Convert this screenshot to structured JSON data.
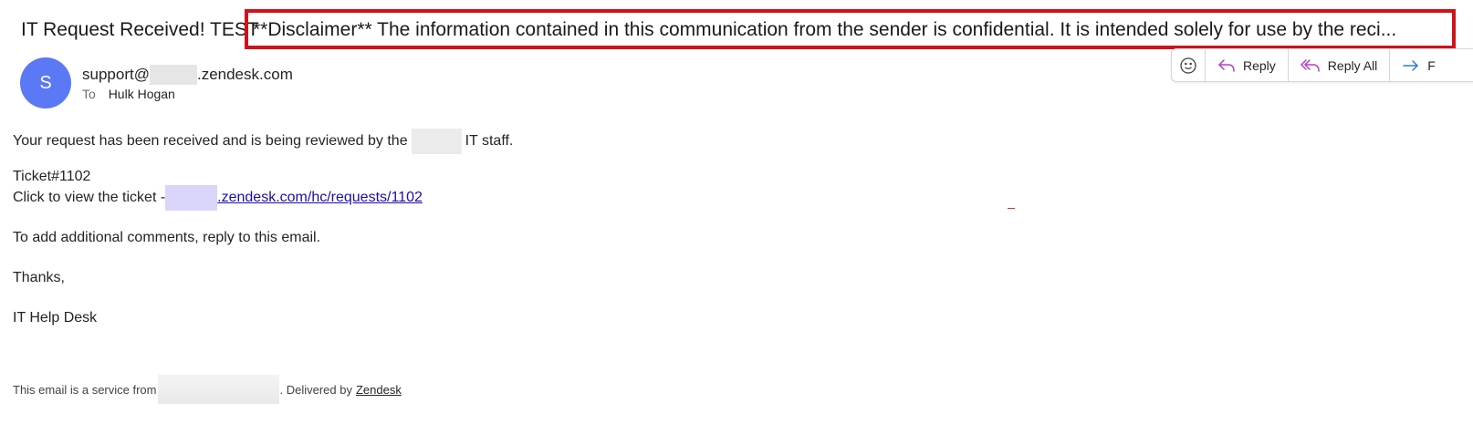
{
  "email": {
    "subject_prefix": "IT Request Received! TEST",
    "subject_disclaimer": "**Disclaimer** The information contained in this communication from the sender is confidential. It is intended solely for use by the reci...",
    "highlight_color": "#d0121b",
    "sender": {
      "avatar_initial": "S",
      "avatar_color": "#5b78f5",
      "address_prefix": "support@",
      "address_suffix": ".zendesk.com"
    },
    "recipient": {
      "label": "To",
      "name": "Hulk Hogan"
    }
  },
  "actions": {
    "emoji_icon": "smiley-icon",
    "reply_label": "Reply",
    "reply_all_label": "Reply All",
    "forward_label": "F"
  },
  "body": {
    "line1_before": "Your request has been received and is being reviewed by the",
    "line1_after": "IT staff.",
    "ticket": "Ticket#1102",
    "view_prefix": "Click to view the ticket -",
    "view_link": ".zendesk.com/hc/requests/1102",
    "comments": "To add additional comments, reply to this email.",
    "thanks": "Thanks,",
    "signature": "IT Help Desk"
  },
  "footer": {
    "prefix": "This email is a service from",
    "delivered": ". Delivered by",
    "zendesk_link": "Zendesk"
  }
}
